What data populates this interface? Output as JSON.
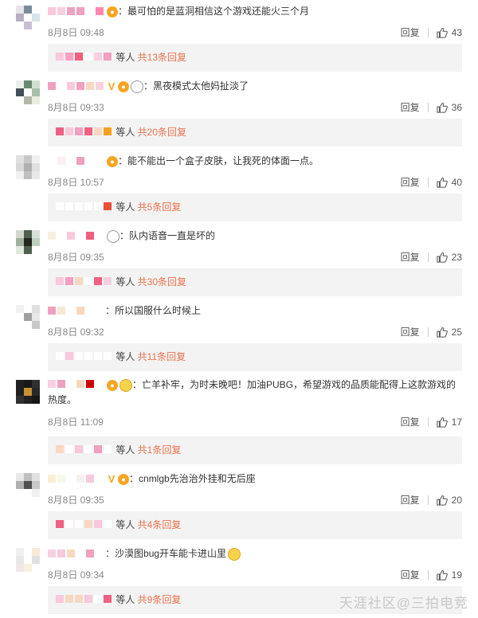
{
  "labels": {
    "reply": "回复",
    "replies_suffix": "等人"
  },
  "comments": [
    {
      "avatar": [
        "#e8e4ec",
        "#7a8a9a",
        "#ffffff",
        "#b8b0c0",
        "#ffffff",
        "#d8e4ea",
        "#ffffff",
        "#c8c0d4",
        "#ffffff"
      ],
      "name_colors": [
        "#f8c8dc",
        "#f8d0e0",
        "#f0a0c0",
        "#f0a0c0",
        "#ffffff",
        "#ff88b0"
      ],
      "icons": [
        "badge"
      ],
      "text": "最可怕的是蓝洞相信这个游戏还能火三个月",
      "time": "8月8日 09:48",
      "likes": "43",
      "reply_name_colors": [
        "#f8c8dc",
        "#ff9ec0",
        "#f06080",
        "#ffffff",
        "#f8d0e0",
        "#f0a0c0"
      ],
      "reply_link": "共13条回复"
    },
    {
      "avatar": [
        "#e8f0e8",
        "#6a8a70",
        "#cfe0d0",
        "#40505a",
        "#ffffff",
        "#a8c0a8",
        "#ffffff",
        "#b0b8a8",
        "#e8ece0"
      ],
      "name_colors": [
        "#f0a0c0",
        "#ffffff",
        "#f8c8dc",
        "#f0a0c0",
        "#f8d8c0",
        "#f8d0e0"
      ],
      "icons": [
        "vip",
        "badge",
        "panda"
      ],
      "text": "黑夜模式太他妈扯淡了",
      "time": "8月8日 09:33",
      "likes": "36",
      "reply_name_colors": [
        "#f06080",
        "#f8c8dc",
        "#f0a0c0",
        "#f06080",
        "#f8d8c0",
        "#f5a020"
      ],
      "reply_link": "共20条回复"
    },
    {
      "avatar": [
        "#e0e0e0",
        "#c8c8c8",
        "#f0f0f0",
        "#d8d8d8",
        "#b0b0b0",
        "#e0e0e0",
        "#f0f0f0",
        "#c0c0c0",
        "#e8e8e8"
      ],
      "name_colors": [
        "#ffffff",
        "#f8f0f4",
        "#ffffff",
        "#f0a0c0",
        "#ffffff",
        "#ffffff"
      ],
      "icons": [
        "badge"
      ],
      "text": "能不能出一个盒子皮肤，让我死的体面一点。",
      "time": "8月8日 10:57",
      "likes": "40",
      "reply_name_colors": [
        "#ffffff",
        "#ffffff",
        "#ffffff",
        "#ffffff",
        "#ffffff",
        "#e8503a"
      ],
      "reply_link": "共5条回复"
    },
    {
      "avatar": [
        "#d0d8d0",
        "#506050",
        "#d8e0d8",
        "#a0b0a0",
        "#202820",
        "#c0d0c0",
        "#e0e8e0",
        "#506050",
        "#ffffff"
      ],
      "name_colors": [
        "#f8f0e0",
        "#ffffff",
        "#f8c8dc",
        "#ffffff",
        "#f06080",
        "#ffffff"
      ],
      "icons": [
        "panda"
      ],
      "text": "队内语音一直是坏的",
      "time": "8月8日 09:35",
      "likes": "23",
      "reply_name_colors": [
        "#f8c8dc",
        "#f0a0c0",
        "#f8d8c0",
        "#ffffff",
        "#f06080",
        "#f8d0e0"
      ],
      "reply_link": "共30条回复"
    },
    {
      "avatar": [
        "#f0f0f0",
        "#ffffff",
        "#e0e0e0",
        "#ffffff",
        "#a0a0a0",
        "#e8e8e8",
        "#ffffff",
        "#ffffff",
        "#c8c8c8"
      ],
      "name_colors": [
        "#f0a0c0",
        "#f8e8d8",
        "#ffffff",
        "#f8d8c0",
        "#ffffff",
        "#ffffff"
      ],
      "icons": [],
      "text": "所以国服什么时候上",
      "time": "8月8日 09:32",
      "likes": "25",
      "reply_name_colors": [
        "#ffffff",
        "#f8c8dc",
        "#ffffff",
        "#ffffff",
        "#ffffff",
        "#ffffff"
      ],
      "reply_link": "共11条回复"
    },
    {
      "avatar": [
        "#202020",
        "#181818",
        "#303030",
        "#202020",
        "#c89030",
        "#282828",
        "#303030",
        "#202020",
        "#181818"
      ],
      "name_colors": [
        "#f8d0e0",
        "#f0a0c0",
        "#ffffff",
        "#f8d8c0",
        "#d00000",
        "#ffffff"
      ],
      "icons": [
        "badge",
        "crown"
      ],
      "text": "亡羊补牢，为时未晚吧！加油PUBG，希望游戏的品质能配得上这款游戏的热度。",
      "time": "8月8日 11:09",
      "likes": "17",
      "reply_name_colors": [
        "#f8d8c0",
        "#ffffff",
        "#f8c8dc",
        "#ffffff",
        "#f0a0c0",
        "#ffffff"
      ],
      "reply_link": "共1条回复"
    },
    {
      "avatar": [
        "#e8e8e8",
        "#c0c0c0",
        "#e0e0e0",
        "#b0b0b0",
        "#505050",
        "#c8c8c8",
        "#ffffff",
        "#ffffff",
        "#f0f0f0"
      ],
      "name_colors": [
        "#f8f0d0",
        "#f8f8e8",
        "#ffffff",
        "#f8f0f0",
        "#f8c8dc",
        "#ffffff"
      ],
      "icons": [
        "vip",
        "badge"
      ],
      "text": "cnmlgb先治治外挂和无后座",
      "time": "8月8日 09:35",
      "likes": "20",
      "reply_name_colors": [
        "#f06080",
        "#ffffff",
        "#ffffff",
        "#f8d8c0",
        "#f8c8dc",
        "#ffffff"
      ],
      "reply_link": "共4条回复"
    },
    {
      "avatar": [
        "#f0f0f0",
        "#ffffff",
        "#f8e8d8",
        "#e8e8e8",
        "#ffffff",
        "#e0e0e0",
        "#f0e8e8",
        "#f8f0e0",
        "#ffffff"
      ],
      "name_colors": [
        "#f8d0e0",
        "#f8c8dc",
        "#f8d8c0",
        "#ffffff",
        "#f0a0c0",
        "#ffffff"
      ],
      "icons": [],
      "text": "沙漠图bug开车能卡进山里",
      "trailing_emoji": true,
      "time": "8月8日 09:34",
      "likes": "19",
      "reply_name_colors": [
        "#f8c8dc",
        "#f8d8c0",
        "#f8d8c0",
        "#f8c8dc",
        "#ffffff",
        "#f06080"
      ],
      "reply_link": "共9条回复"
    }
  ],
  "watermark": "天涯社区@三拍电竞"
}
